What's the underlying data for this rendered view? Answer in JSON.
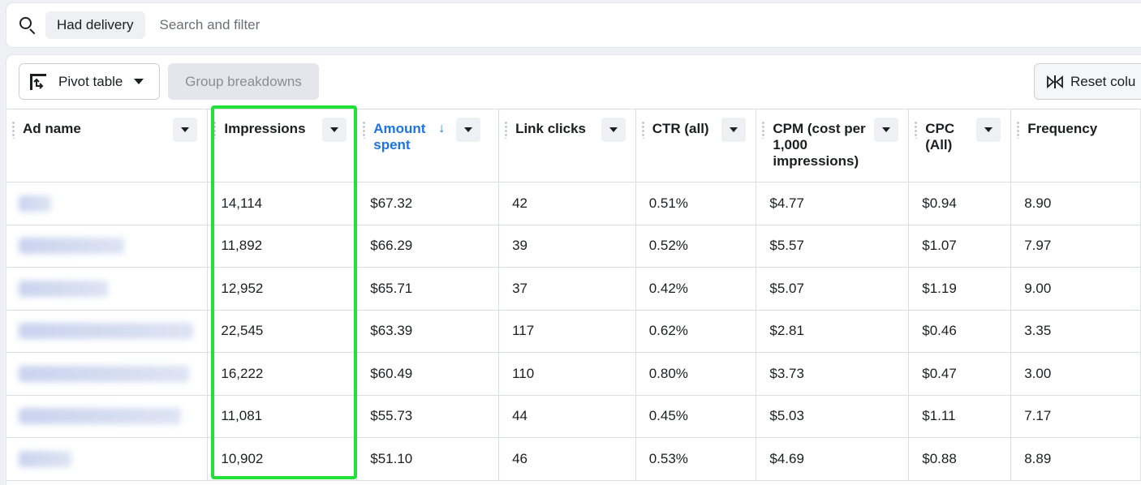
{
  "search": {
    "chip_label": "Had delivery",
    "placeholder": "Search and filter"
  },
  "toolbar": {
    "pivot_label": "Pivot table",
    "group_label": "Group breakdowns",
    "reset_label": "Reset colu"
  },
  "table": {
    "columns": [
      {
        "label": "Ad name"
      },
      {
        "label": "Impressions"
      },
      {
        "label": "Amount spent",
        "sort": "descending"
      },
      {
        "label": "Link clicks"
      },
      {
        "label": "CTR (all)"
      },
      {
        "label": "CPM (cost per 1,000 impressions)"
      },
      {
        "label": "CPC (All)"
      },
      {
        "label": "Frequency"
      }
    ],
    "rows": [
      {
        "impressions": "14,114",
        "amount_spent": "$67.32",
        "link_clicks": "42",
        "ctr": "0.51%",
        "cpm": "$4.77",
        "cpc": "$0.94",
        "frequency": "8.90"
      },
      {
        "impressions": "11,892",
        "amount_spent": "$66.29",
        "link_clicks": "39",
        "ctr": "0.52%",
        "cpm": "$5.57",
        "cpc": "$1.07",
        "frequency": "7.97"
      },
      {
        "impressions": "12,952",
        "amount_spent": "$65.71",
        "link_clicks": "37",
        "ctr": "0.42%",
        "cpm": "$5.07",
        "cpc": "$1.19",
        "frequency": "9.00"
      },
      {
        "impressions": "22,545",
        "amount_spent": "$63.39",
        "link_clicks": "117",
        "ctr": "0.62%",
        "cpm": "$2.81",
        "cpc": "$0.46",
        "frequency": "3.35"
      },
      {
        "impressions": "16,222",
        "amount_spent": "$60.49",
        "link_clicks": "110",
        "ctr": "0.80%",
        "cpm": "$3.73",
        "cpc": "$0.47",
        "frequency": "3.00"
      },
      {
        "impressions": "11,081",
        "amount_spent": "$55.73",
        "link_clicks": "44",
        "ctr": "0.45%",
        "cpm": "$5.03",
        "cpc": "$1.11",
        "frequency": "7.17"
      },
      {
        "impressions": "10,902",
        "amount_spent": "$51.10",
        "link_clicks": "46",
        "ctr": "0.53%",
        "cpm": "$4.69",
        "cpc": "$0.88",
        "frequency": "8.89"
      }
    ]
  },
  "icons": {
    "search": "search-icon",
    "pivot": "pivot-table-icon",
    "dropdown": "caret-down-icon",
    "reset": "reset-columns-icon",
    "sort": "arrow-down-icon",
    "grip": "drag-handle-icon"
  },
  "colors": {
    "accent": "#1b74e4",
    "highlight": "#22e03a",
    "chip_bg": "#eef0f3"
  }
}
